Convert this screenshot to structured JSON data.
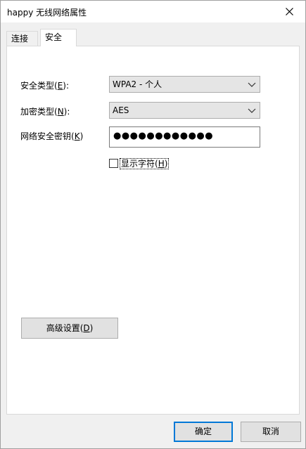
{
  "window": {
    "title": "happy 无线网络属性"
  },
  "tabs": [
    {
      "label": "连接"
    },
    {
      "label": "安全"
    }
  ],
  "security_type": {
    "label_prefix": "安全类型(",
    "accel": "E",
    "label_suffix": "):",
    "value": "WPA2 - 个人"
  },
  "encryption_type": {
    "label_prefix": "加密类型(",
    "accel": "N",
    "label_suffix": "):",
    "value": "AES"
  },
  "network_key": {
    "label_prefix": "网络安全密钥(",
    "accel": "K",
    "label_suffix": ")",
    "value": "●●●●●●●●●●●●"
  },
  "show_chars": {
    "label_prefix": "显示字符(",
    "accel": "H",
    "label_suffix": ")"
  },
  "advanced": {
    "label_prefix": "高级设置(",
    "accel": "D",
    "label_suffix": ")"
  },
  "buttons": {
    "ok": "确定",
    "cancel": "取消"
  }
}
